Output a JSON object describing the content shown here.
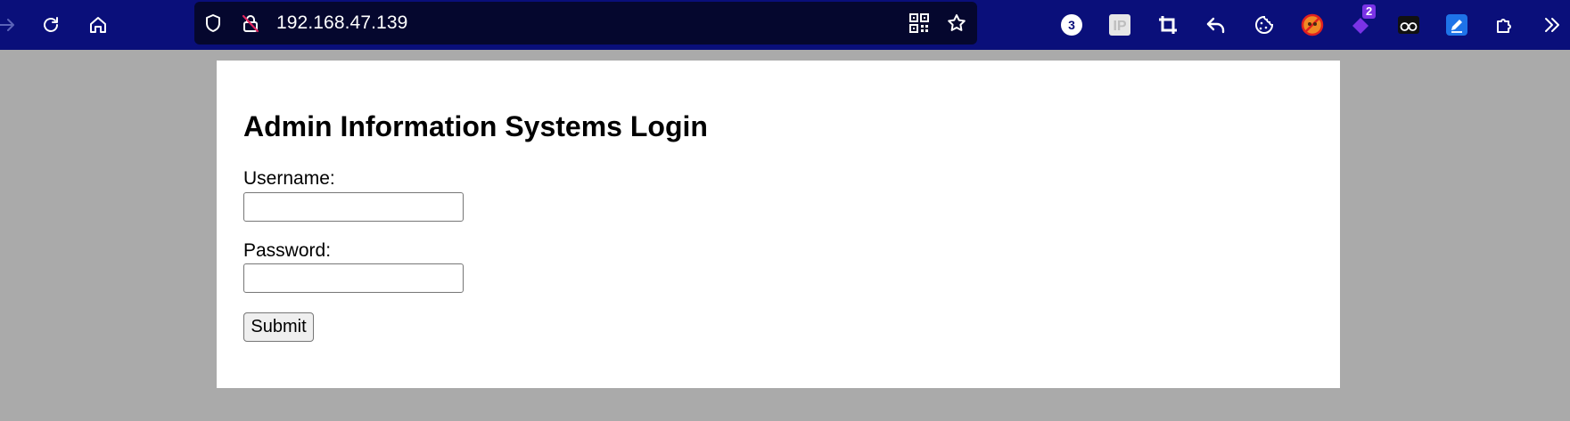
{
  "browser": {
    "url": "192.168.47.139",
    "toolbar_color": "#0a0f7a",
    "urlbar_color": "#05072e",
    "nav_icons": [
      "forward-arrow-icon",
      "reload-icon",
      "home-icon"
    ],
    "urlbar_icons": [
      "shield-icon",
      "insecure-lock-icon",
      "qr-code-icon",
      "bookmark-star-icon"
    ],
    "extensions": [
      {
        "name": "counter-badge-icon",
        "badge": "3"
      },
      {
        "name": "ip-icon",
        "label": "IP"
      },
      {
        "name": "crop-icon"
      },
      {
        "name": "undo-arrow-icon"
      },
      {
        "name": "cookie-icon"
      },
      {
        "name": "blocked-extension-icon"
      },
      {
        "name": "purple-extension-icon",
        "badge": "2"
      },
      {
        "name": "glasses-icon"
      },
      {
        "name": "edit-icon"
      },
      {
        "name": "extensions-puzzle-icon"
      },
      {
        "name": "overflow-chevron-icon"
      }
    ]
  },
  "page": {
    "background": "#aaaaaa",
    "title": "Admin Information Systems Login",
    "form": {
      "username_label": "Username:",
      "username_value": "",
      "password_label": "Password:",
      "password_value": "",
      "submit_label": "Submit"
    }
  }
}
